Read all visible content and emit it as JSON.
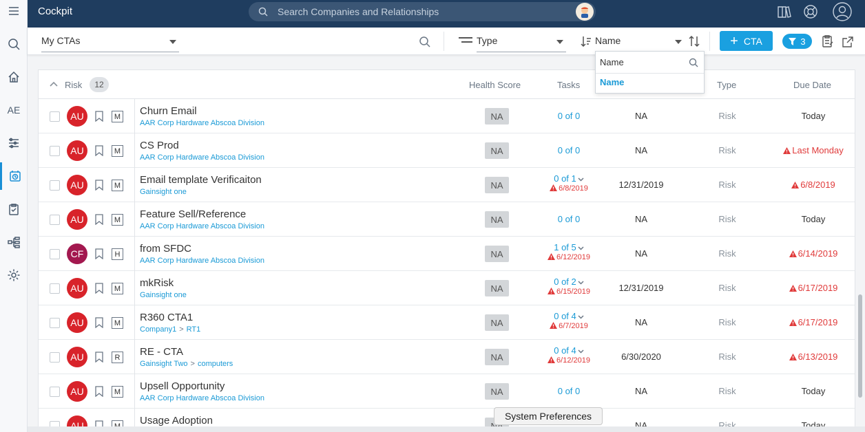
{
  "app": {
    "title": "Cockpit"
  },
  "search": {
    "placeholder": "Search Companies and Relationships"
  },
  "rail": {
    "ae_label": "AE"
  },
  "toolbar": {
    "view_select": "My CTAs",
    "type_select": "Type",
    "sort_select": "Name",
    "cta_button": "CTA",
    "filter_count": "3"
  },
  "sort_dropdown": {
    "input_value": "Name",
    "option": "Name"
  },
  "group": {
    "label": "Risk",
    "count": "12"
  },
  "columns": {
    "health_score": "Health Score",
    "tasks": "Tasks",
    "type": "Type",
    "due_date": "Due Date"
  },
  "rows": [
    {
      "initials": "AU",
      "avatar_color": "#d8232a",
      "priority": "M",
      "name": "Churn Email",
      "company": "AAR Corp Hardware Abscoa Division",
      "relationship": "",
      "health": "NA",
      "tasks": "0 of 0",
      "task_date": "",
      "close": "NA",
      "type": "Risk",
      "due": "Today",
      "overdue": false
    },
    {
      "initials": "AU",
      "avatar_color": "#d8232a",
      "priority": "M",
      "name": "CS Prod",
      "company": "AAR Corp Hardware Abscoa Division",
      "relationship": "",
      "health": "NA",
      "tasks": "0 of 0",
      "task_date": "",
      "close": "NA",
      "type": "Risk",
      "due": "Last Monday",
      "overdue": true
    },
    {
      "initials": "AU",
      "avatar_color": "#d8232a",
      "priority": "M",
      "name": "Email template Verificaiton",
      "company": "Gainsight one",
      "relationship": "",
      "health": "NA",
      "tasks": "0 of 1",
      "task_date": "6/8/2019",
      "close": "12/31/2019",
      "type": "Risk",
      "due": "6/8/2019",
      "overdue": true
    },
    {
      "initials": "AU",
      "avatar_color": "#d8232a",
      "priority": "M",
      "name": "Feature Sell/Reference",
      "company": "AAR Corp Hardware Abscoa Division",
      "relationship": "",
      "health": "NA",
      "tasks": "0 of 0",
      "task_date": "",
      "close": "NA",
      "type": "Risk",
      "due": "Today",
      "overdue": false
    },
    {
      "initials": "CF",
      "avatar_color": "#a3184f",
      "priority": "H",
      "name": "from SFDC",
      "company": "AAR Corp Hardware Abscoa Division",
      "relationship": "",
      "health": "NA",
      "tasks": "1 of 5",
      "task_date": "6/12/2019",
      "close": "NA",
      "type": "Risk",
      "due": "6/14/2019",
      "overdue": true
    },
    {
      "initials": "AU",
      "avatar_color": "#d8232a",
      "priority": "M",
      "name": "mkRisk",
      "company": "Gainsight one",
      "relationship": "",
      "health": "NA",
      "tasks": "0 of 2",
      "task_date": "6/15/2019",
      "close": "12/31/2019",
      "type": "Risk",
      "due": "6/17/2019",
      "overdue": true
    },
    {
      "initials": "AU",
      "avatar_color": "#d8232a",
      "priority": "M",
      "name": "R360 CTA1",
      "company": "Company1",
      "relationship": "RT1",
      "health": "NA",
      "tasks": "0 of 4",
      "task_date": "6/7/2019",
      "close": "NA",
      "type": "Risk",
      "due": "6/17/2019",
      "overdue": true
    },
    {
      "initials": "AU",
      "avatar_color": "#d8232a",
      "priority": "R",
      "name": "RE - CTA",
      "company": "Gainsight Two",
      "relationship": "computers",
      "health": "NA",
      "tasks": "0 of 4",
      "task_date": "6/12/2019",
      "close": "6/30/2020",
      "type": "Risk",
      "due": "6/13/2019",
      "overdue": true
    },
    {
      "initials": "AU",
      "avatar_color": "#d8232a",
      "priority": "M",
      "name": "Upsell Opportunity",
      "company": "AAR Corp Hardware Abscoa Division",
      "relationship": "",
      "health": "NA",
      "tasks": "0 of 0",
      "task_date": "",
      "close": "NA",
      "type": "Risk",
      "due": "Today",
      "overdue": false
    },
    {
      "initials": "AU",
      "avatar_color": "#d8232a",
      "priority": "M",
      "name": "Usage Adoption",
      "company": "",
      "relationship": "",
      "health": "NA",
      "tasks": "",
      "task_date": "",
      "close": "NA",
      "type": "Risk",
      "due": "Today",
      "overdue": false
    }
  ],
  "tooltip": {
    "text": "System Preferences"
  },
  "colors": {
    "topbar": "#1f3d5f",
    "accent": "#1aa0e0",
    "danger": "#e03a3a",
    "link": "#1a9ad6"
  }
}
